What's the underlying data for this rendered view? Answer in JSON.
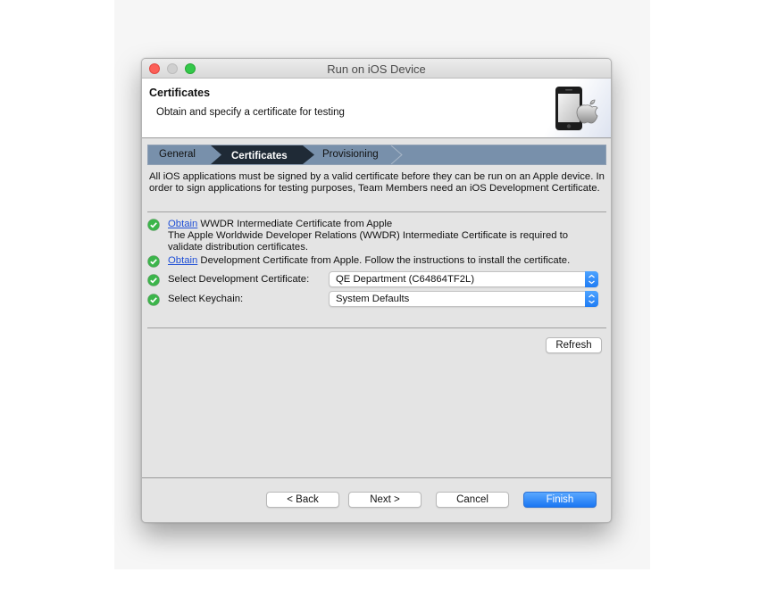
{
  "window": {
    "title": "Run on iOS Device"
  },
  "header": {
    "title": "Certificates",
    "subtitle": "Obtain and specify a certificate for testing",
    "icon": "ios-device-apple-icon"
  },
  "steps": [
    {
      "label": "General",
      "state": "done"
    },
    {
      "label": "Certificates",
      "state": "active"
    },
    {
      "label": "Provisioning",
      "state": "pending"
    }
  ],
  "intro_text": "All iOS applications must be signed by a valid certificate before they can be run on an Apple device. In order to sign applications for testing purposes, Team Members need an iOS Development Certificate.",
  "checks": [
    {
      "link": "Obtain",
      "text": " WWDR Intermediate Certificate from Apple",
      "detail_line1": "The Apple Worldwide Developer Relations (WWDR) Intermediate Certificate is required to",
      "detail_line2": "validate distribution certificates."
    },
    {
      "link": "Obtain",
      "text": " Development Certificate from Apple. Follow the instructions to install the certificate."
    },
    {
      "label": "Select Development Certificate:",
      "value": "QE Department (C64864TF2L)"
    },
    {
      "label": "Select Keychain:",
      "value": "System Defaults"
    }
  ],
  "buttons": {
    "refresh": "Refresh",
    "back": "< Back",
    "next": "Next >",
    "cancel": "Cancel",
    "finish": "Finish"
  },
  "colors": {
    "accent": "#1a76f2",
    "step_bar": "#7890ab",
    "step_active": "#1f2a36",
    "check": "#3bb54a",
    "link": "#1f4fd6"
  }
}
